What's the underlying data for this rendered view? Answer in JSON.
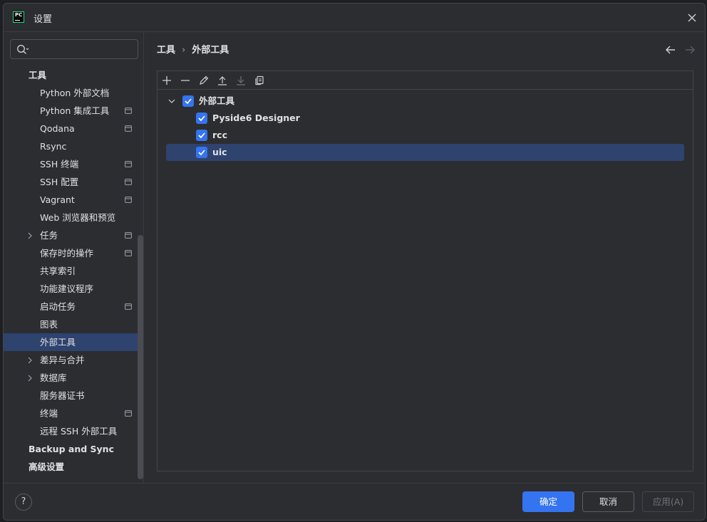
{
  "window": {
    "title": "设置",
    "app_logo_text": "PC"
  },
  "search": {
    "value": "",
    "placeholder": ""
  },
  "sidebar": {
    "items": [
      {
        "label": "工具",
        "level": 0,
        "expandable": false,
        "project_icon": false,
        "selected": false
      },
      {
        "label": "Python 外部文档",
        "level": 1,
        "expandable": false,
        "project_icon": false,
        "selected": false
      },
      {
        "label": "Python 集成工具",
        "level": 1,
        "expandable": false,
        "project_icon": true,
        "selected": false
      },
      {
        "label": "Qodana",
        "level": 1,
        "expandable": false,
        "project_icon": true,
        "selected": false
      },
      {
        "label": "Rsync",
        "level": 1,
        "expandable": false,
        "project_icon": false,
        "selected": false
      },
      {
        "label": "SSH 终端",
        "level": 1,
        "expandable": false,
        "project_icon": true,
        "selected": false
      },
      {
        "label": "SSH 配置",
        "level": 1,
        "expandable": false,
        "project_icon": true,
        "selected": false
      },
      {
        "label": "Vagrant",
        "level": 1,
        "expandable": false,
        "project_icon": true,
        "selected": false
      },
      {
        "label": "Web 浏览器和预览",
        "level": 1,
        "expandable": false,
        "project_icon": false,
        "selected": false
      },
      {
        "label": "任务",
        "level": 1,
        "expandable": true,
        "project_icon": true,
        "selected": false
      },
      {
        "label": "保存时的操作",
        "level": 1,
        "expandable": false,
        "project_icon": true,
        "selected": false
      },
      {
        "label": "共享索引",
        "level": 1,
        "expandable": false,
        "project_icon": false,
        "selected": false
      },
      {
        "label": "功能建议程序",
        "level": 1,
        "expandable": false,
        "project_icon": false,
        "selected": false
      },
      {
        "label": "启动任务",
        "level": 1,
        "expandable": false,
        "project_icon": true,
        "selected": false
      },
      {
        "label": "图表",
        "level": 1,
        "expandable": false,
        "project_icon": false,
        "selected": false
      },
      {
        "label": "外部工具",
        "level": 1,
        "expandable": false,
        "project_icon": false,
        "selected": true
      },
      {
        "label": "差异与合并",
        "level": 1,
        "expandable": true,
        "project_icon": false,
        "selected": false
      },
      {
        "label": "数据库",
        "level": 1,
        "expandable": true,
        "project_icon": false,
        "selected": false
      },
      {
        "label": "服务器证书",
        "level": 1,
        "expandable": false,
        "project_icon": false,
        "selected": false
      },
      {
        "label": "终端",
        "level": 1,
        "expandable": false,
        "project_icon": true,
        "selected": false
      },
      {
        "label": "远程 SSH 外部工具",
        "level": 1,
        "expandable": false,
        "project_icon": false,
        "selected": false
      },
      {
        "label": "Backup and Sync",
        "level": 0,
        "expandable": false,
        "project_icon": false,
        "selected": false
      },
      {
        "label": "高级设置",
        "level": 0,
        "expandable": false,
        "project_icon": false,
        "selected": false
      }
    ]
  },
  "breadcrumb": {
    "parent": "工具",
    "separator": "›",
    "current": "外部工具"
  },
  "toolbar": {
    "buttons": [
      "add-icon",
      "remove-icon",
      "edit-icon",
      "move-up-icon",
      "move-down-icon",
      "copy-icon"
    ]
  },
  "tools": {
    "group": {
      "label": "外部工具",
      "checked": true,
      "expanded": true
    },
    "items": [
      {
        "label": "Pyside6 Designer",
        "checked": true,
        "selected": false
      },
      {
        "label": "rcc",
        "checked": true,
        "selected": false
      },
      {
        "label": "uic",
        "checked": true,
        "selected": true
      }
    ]
  },
  "footer": {
    "help": "?",
    "ok": "确定",
    "cancel": "取消",
    "apply": "应用(A)"
  },
  "colors": {
    "accent": "#3574f0",
    "selection": "#2e436e",
    "background": "#2b2d30",
    "text": "#dfe1e5"
  }
}
